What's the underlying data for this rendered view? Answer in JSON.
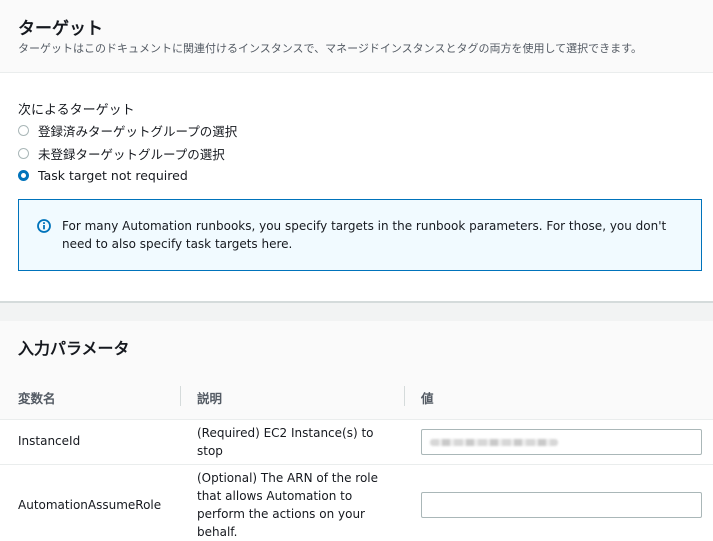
{
  "target": {
    "title": "ターゲット",
    "description": "ターゲットはこのドキュメントに関連付けるインスタンスで、マネージドインスタンスとタグの両方を使用して選択できます。",
    "group_label": "次によるターゲット",
    "options": [
      {
        "label": "登録済みターゲットグループの選択",
        "selected": false
      },
      {
        "label": "未登録ターゲットグループの選択",
        "selected": false
      },
      {
        "label": "Task target not required",
        "selected": true
      }
    ],
    "info": {
      "icon": "info-icon",
      "text": "For many Automation runbooks, you specify targets in the runbook parameters. For those, you don't need to also specify task targets here."
    }
  },
  "params": {
    "title": "入力パラメータ",
    "columns": [
      "変数名",
      "説明",
      "値"
    ],
    "rows": [
      {
        "name": "InstanceId",
        "description": "(Required) EC2 Instance(s) to stop",
        "value_redacted": true
      },
      {
        "name": "AutomationAssumeRole",
        "description": "(Optional) The ARN of the role that allows Automation to perform the actions on your behalf.",
        "value": ""
      }
    ]
  },
  "colors": {
    "accent": "#0073bb",
    "info_bg": "#f1faff"
  }
}
